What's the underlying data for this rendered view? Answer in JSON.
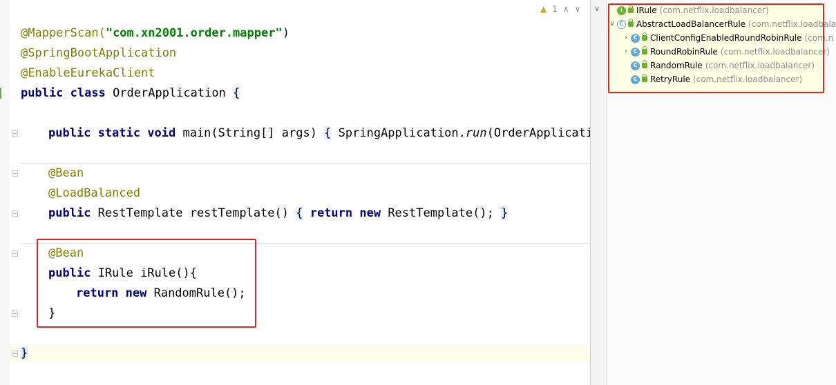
{
  "editor": {
    "inspection": {
      "warning_icon": "warning-icon",
      "count": "1",
      "prev": "∧",
      "next": "∨"
    },
    "code": {
      "mapper_scan_annotation": "@MapperScan(",
      "mapper_scan_value": "\"com.xn2001.order.mapper\"",
      "mapper_scan_close": ")",
      "spring_boot_annotation": "@SpringBootApplication",
      "eureka_annotation": "@EnableEurekaClient",
      "class_modifiers": "public class",
      "class_name": " OrderApplication ",
      "class_open_brace": "{",
      "main_modifiers": "public static void",
      "main_signature": " main(String[] args) ",
      "main_open": "{",
      "main_body_prefix": " SpringApplication.",
      "main_body_run": "run",
      "main_body_suffix": "(OrderApplication",
      "bean1_annotation": "@Bean",
      "load_balanced_annotation": "@LoadBalanced",
      "rest_modifier": "public",
      "rest_signature": " RestTemplate restTemplate() ",
      "rest_open": "{",
      "rest_return": " return new",
      "rest_body": " RestTemplate(); ",
      "rest_close": "}",
      "bean2_annotation": "@Bean",
      "irule_modifier": "public",
      "irule_signature": " IRule iRule(){",
      "irule_return": "return new",
      "irule_body": " RandomRule();",
      "irule_close": "}",
      "class_close_brace": "}"
    }
  },
  "hierarchy": {
    "nodes": [
      {
        "name": "IRule",
        "package": "(com.netflix.loadbalancer)",
        "icon": "interface-icon",
        "letter": "I"
      },
      {
        "name": "AbstractLoadBalancerRule",
        "package": "(com.netflix.loadbalan",
        "icon": "abstract-class-icon",
        "letter": "C"
      },
      {
        "name": "ClientConfigEnabledRoundRobinRule",
        "package": "(com.n",
        "icon": "class-icon",
        "letter": "C"
      },
      {
        "name": "RoundRobinRule",
        "package": "(com.netflix.loadbalancer)",
        "icon": "class-icon",
        "letter": "C"
      },
      {
        "name": "RandomRule",
        "package": "(com.netflix.loadbalancer)",
        "icon": "class-icon",
        "letter": "C"
      },
      {
        "name": "RetryRule",
        "package": "(com.netflix.loadbalancer)",
        "icon": "class-icon",
        "letter": "C"
      }
    ],
    "toggles": {
      "expanded": "∨",
      "collapsed": "›"
    }
  },
  "colors": {
    "highlight_box": "#e0261c",
    "keyword": "#000080",
    "annotation": "#808000",
    "string": "#008000"
  }
}
